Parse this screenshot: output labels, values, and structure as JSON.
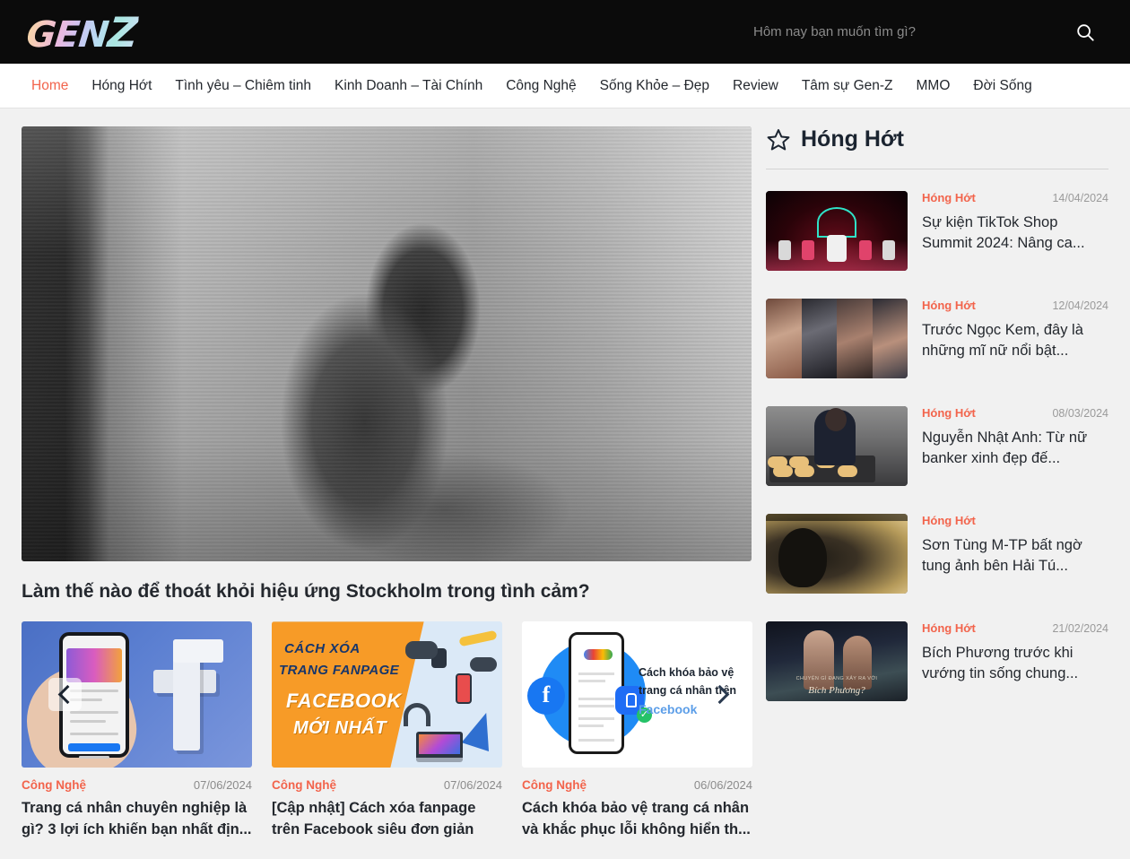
{
  "header": {
    "logo_text_a": "GEN",
    "logo_text_b": "Z",
    "search_placeholder": "Hôm nay bạn muốn tìm gì?",
    "search_value": "",
    "search_icon": "search-icon"
  },
  "nav": {
    "items": [
      {
        "label": "Home",
        "active": true
      },
      {
        "label": "Hóng Hớt",
        "active": false
      },
      {
        "label": "Tình yêu – Chiêm tinh",
        "active": false
      },
      {
        "label": "Kinh Doanh – Tài Chính",
        "active": false
      },
      {
        "label": "Công Nghệ",
        "active": false
      },
      {
        "label": "Sống Khỏe – Đẹp",
        "active": false
      },
      {
        "label": "Review",
        "active": false
      },
      {
        "label": "Tâm sự Gen-Z",
        "active": false
      },
      {
        "label": "MMO",
        "active": false
      },
      {
        "label": "Đời Sống",
        "active": false
      }
    ]
  },
  "hero": {
    "title": "Làm thế nào để thoát khỏi hiệu ứng Stockholm trong tình cảm?",
    "image_alt": "black-and-white photo of a person sitting curled up by a window"
  },
  "carousel": {
    "prev_label": "‹",
    "next_label": "›",
    "cards": [
      {
        "category": "Công Nghệ",
        "date": "07/06/2024",
        "title": "Trang cá nhân chuyên nghiệp là gì? 3 lợi ích khiến bạn nhất địn...",
        "thumb_alt": "hand holding phone next to white 3D Facebook logo"
      },
      {
        "category": "Công Nghệ",
        "date": "07/06/2024",
        "title": "[Cập nhật] Cách xóa fanpage trên Facebook siêu đơn giản",
        "thumb_alt": "orange banner",
        "thumb_text": {
          "line1": "CÁCH XÓA",
          "line2": "TRANG FANPAGE",
          "line3": "FACEBOOK",
          "line4": "MỚI NHẤT"
        }
      },
      {
        "category": "Công Nghệ",
        "date": "06/06/2024",
        "title": "Cách khóa bảo vệ trang cá nhân và khắc phục lỗi không hiển th...",
        "thumb_alt": "phone with Facebook lock illustration",
        "thumb_text": {
          "line1": "Cách khóa bảo vệ trang cá nhân trên",
          "line2": "Facebook"
        }
      }
    ]
  },
  "sidebar": {
    "title": "Hóng Hớt",
    "icon": "star-icon",
    "items": [
      {
        "category": "Hóng Hớt",
        "date": "14/04/2024",
        "title": "Sự kiện TikTok Shop Summit 2024: Nâng ca...",
        "thumb_alt": "neon-lit TikTok Shop Summit stage"
      },
      {
        "category": "Hóng Hớt",
        "date": "12/04/2024",
        "title": "Trước Ngọc Kem, đây là những mĩ nữ nổi bật...",
        "thumb_alt": "collage of four women"
      },
      {
        "category": "Hóng Hớt",
        "date": "08/03/2024",
        "title": "Nguyễn Nhật Anh: Từ nữ banker xinh đẹp đế...",
        "thumb_alt": "woman baking bread in a kitchen"
      },
      {
        "category": "Hóng Hớt",
        "date": "",
        "title": "Sơn Tùng M-TP bất ngờ tung ảnh bên Hải Tú...",
        "thumb_alt": "dim golden silhouette photo"
      },
      {
        "category": "Hóng Hớt",
        "date": "21/02/2024",
        "title": "Bích Phương trước khi vướng tin sống chung...",
        "thumb_alt": "two women at night, caption Bích Phương?",
        "thumb_text": {
          "line1": "CHUYỆN GÌ ĐANG XẢY RA VỚI",
          "line2": "Bích Phương?"
        }
      }
    ]
  },
  "colors": {
    "accent": "#f2644c",
    "header_bg": "#0b0b0b",
    "page_bg": "#f1f1f1",
    "text": "#24282e",
    "muted": "#9a9a9a"
  }
}
